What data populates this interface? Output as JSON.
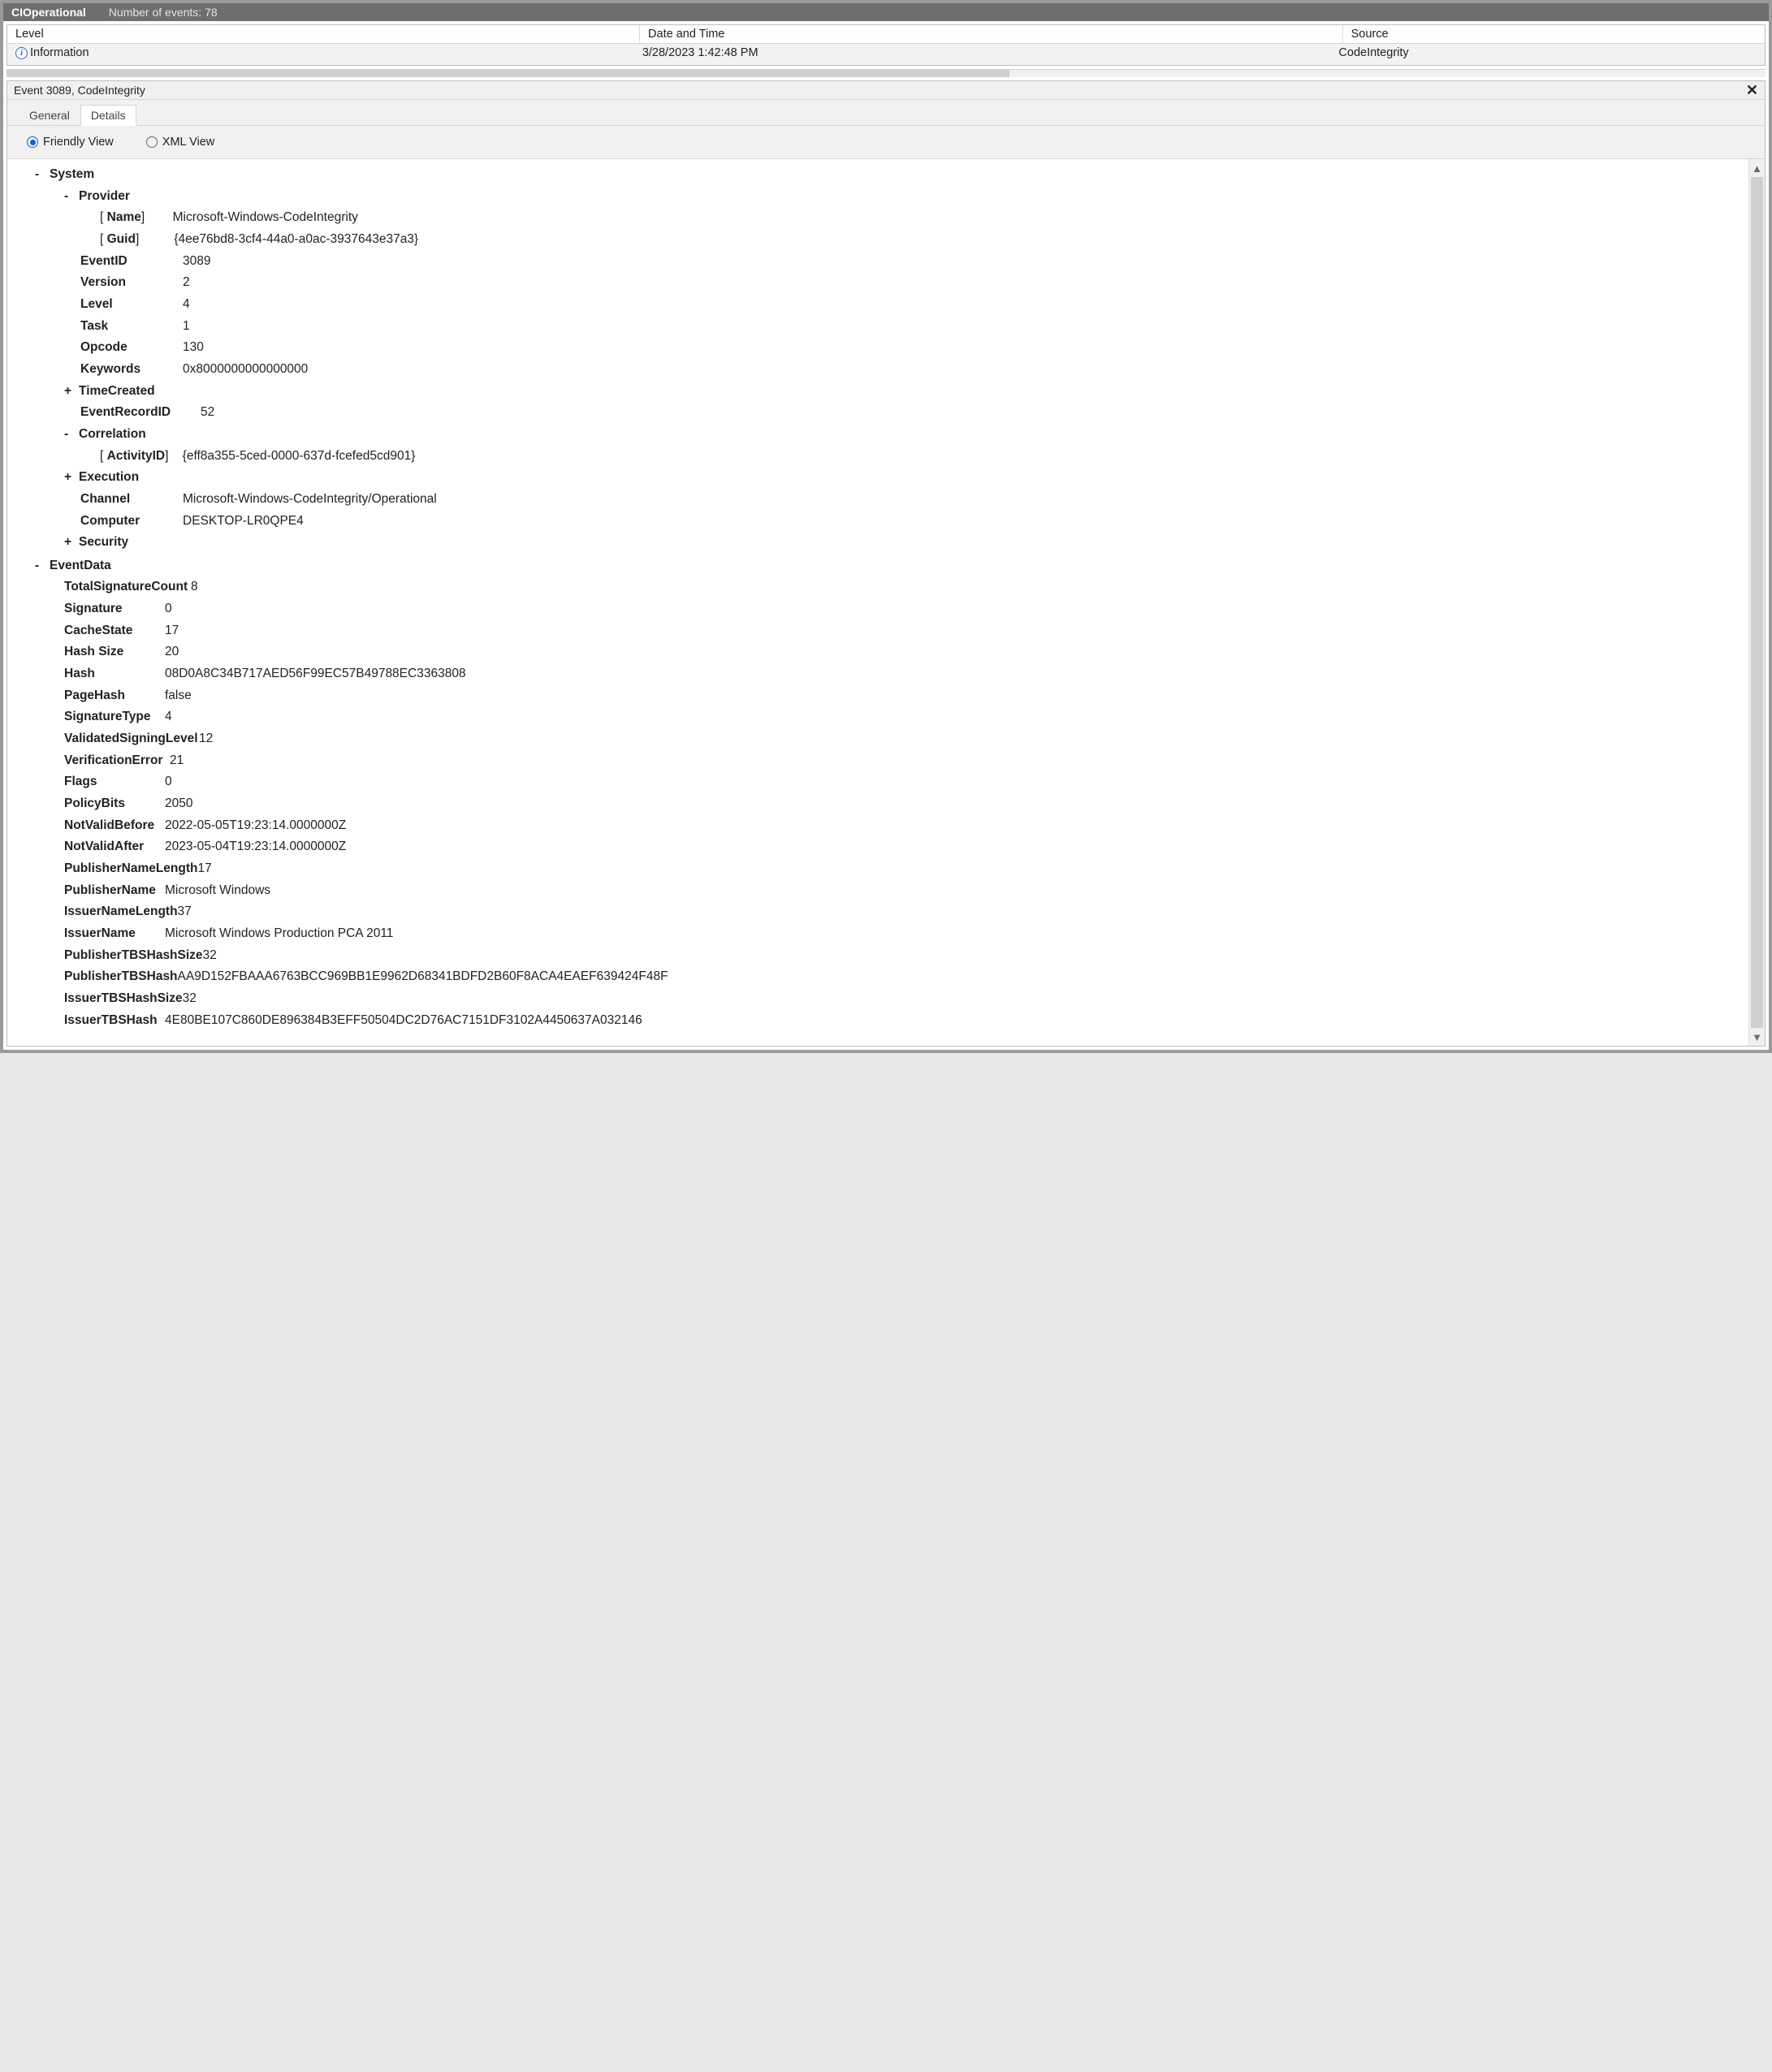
{
  "window": {
    "app": "CIOperational",
    "subtitle": "Number of events: 78"
  },
  "grid": {
    "columns": {
      "level": "Level",
      "date": "Date and Time",
      "source": "Source"
    },
    "row": {
      "level": "Information",
      "date": "3/28/2023 1:42:48 PM",
      "source": "CodeIntegrity"
    }
  },
  "detail": {
    "header": "Event 3089, CodeIntegrity",
    "tabs": {
      "general": "General",
      "details": "Details"
    },
    "view": {
      "friendly": "Friendly View",
      "xml": "XML View"
    }
  },
  "system": {
    "section": "System",
    "provider": {
      "label": "Provider",
      "name_label": "Name",
      "name": "Microsoft-Windows-CodeIntegrity",
      "guid_label": "Guid",
      "guid": "{4ee76bd8-3cf4-44a0-a0ac-3937643e37a3}"
    },
    "eventid": {
      "k": "EventID",
      "v": "3089"
    },
    "version": {
      "k": "Version",
      "v": "2"
    },
    "level": {
      "k": "Level",
      "v": "4"
    },
    "task": {
      "k": "Task",
      "v": "1"
    },
    "opcode": {
      "k": "Opcode",
      "v": "130"
    },
    "keywords": {
      "k": "Keywords",
      "v": "0x8000000000000000"
    },
    "timecreated": {
      "k": "TimeCreated"
    },
    "eventrecid": {
      "k": "EventRecordID",
      "v": "52"
    },
    "correlation": {
      "label": "Correlation",
      "activity_label": "ActivityID",
      "activity": "{eff8a355-5ced-0000-637d-fcefed5cd901}"
    },
    "execution": {
      "k": "Execution"
    },
    "channel": {
      "k": "Channel",
      "v": "Microsoft-Windows-CodeIntegrity/Operational"
    },
    "computer": {
      "k": "Computer",
      "v": "DESKTOP-LR0QPE4"
    },
    "security": {
      "k": "Security"
    }
  },
  "eventdata": {
    "section": "EventData",
    "rows": [
      {
        "k": "TotalSignatureCount",
        "v": "8"
      },
      {
        "k": "Signature",
        "v": "0"
      },
      {
        "k": "CacheState",
        "v": "17"
      },
      {
        "k": "Hash Size",
        "v": "20"
      },
      {
        "k": "Hash",
        "v": "08D0A8C34B717AED56F99EC57B49788EC3363808"
      },
      {
        "k": "PageHash",
        "v": "false"
      },
      {
        "k": "SignatureType",
        "v": "4"
      },
      {
        "k": "ValidatedSigningLevel",
        "v": "12"
      },
      {
        "k": "VerificationError",
        "v": "21"
      },
      {
        "k": "Flags",
        "v": "0"
      },
      {
        "k": "PolicyBits",
        "v": "2050"
      },
      {
        "k": "NotValidBefore",
        "v": "2022-05-05T19:23:14.0000000Z"
      },
      {
        "k": "NotValidAfter",
        "v": "2023-05-04T19:23:14.0000000Z"
      },
      {
        "k": "PublisherNameLength",
        "v": "17"
      },
      {
        "k": "PublisherName",
        "v": "Microsoft Windows"
      },
      {
        "k": "IssuerNameLength",
        "v": "37"
      },
      {
        "k": "IssuerName",
        "v": "Microsoft Windows Production PCA 2011"
      },
      {
        "k": "PublisherTBSHashSize",
        "v": "32"
      },
      {
        "k": "PublisherTBSHash",
        "v": "AA9D152FBAAA6763BCC969BB1E9962D68341BDFD2B60F8ACA4EAEF639424F48F"
      },
      {
        "k": "IssuerTBSHashSize",
        "v": "32"
      },
      {
        "k": "IssuerTBSHash",
        "v": "4E80BE107C860DE896384B3EFF50504DC2D76AC7151DF3102A4450637A032146"
      }
    ]
  },
  "ed_key_widths": {
    "base": 124,
    "TotalSignatureCount": 156,
    "ValidatedSigningLevel": 166,
    "VerificationError": 130,
    "PublisherNameLength": 158,
    "PublisherName": 124,
    "IssuerNameLength": 136,
    "PublisherTBSHashSize": 164,
    "PublisherTBSHash": 134,
    "IssuerTBSHashSize": 140,
    "IssuerTBSHash": 124
  }
}
